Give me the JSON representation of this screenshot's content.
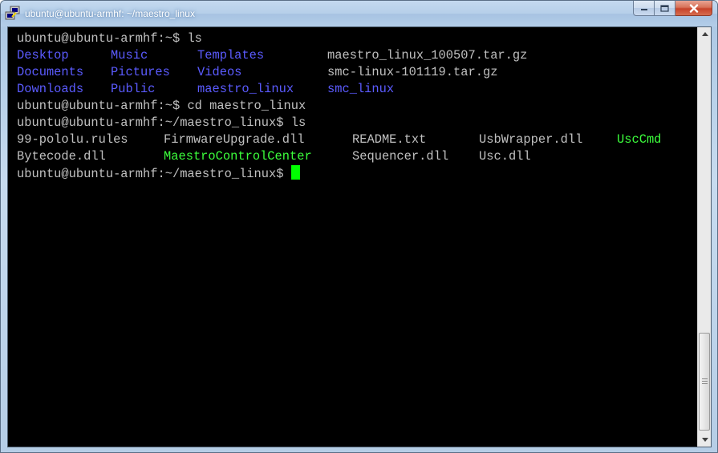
{
  "window": {
    "title": "ubuntu@ubuntu-armhf: ~/maestro_linux"
  },
  "colors": {
    "background": "#000000",
    "text": "#c0c0c0",
    "directory": "#5b5bff",
    "executable": "#3cff3c",
    "cursor": "#00ff00"
  },
  "terminal": {
    "l1": {
      "prompt": "ubuntu@ubuntu-armhf:~$",
      "command": " ls"
    },
    "l2": {
      "c1": "Desktop",
      "c2": "Music",
      "c3": "Templates",
      "c4": "maestro_linux_100507.tar.gz"
    },
    "l3": {
      "c1": "Documents",
      "c2": "Pictures",
      "c3": "Videos",
      "c4": "smc-linux-101119.tar.gz"
    },
    "l4": {
      "c1": "Downloads",
      "c2": "Public",
      "c3": "maestro_linux",
      "c4": "smc_linux"
    },
    "l5": {
      "prompt": "ubuntu@ubuntu-armhf:~$",
      "command": " cd maestro_linux"
    },
    "l6": {
      "prompt": "ubuntu@ubuntu-armhf:~/maestro_linux$",
      "command": " ls"
    },
    "l7": {
      "c1": "99-pololu.rules",
      "c2": "FirmwareUpgrade.dll",
      "c3": "README.txt",
      "c4": "UsbWrapper.dll",
      "c5": "UscCmd"
    },
    "l8": {
      "c1": "Bytecode.dll",
      "c2": "MaestroControlCenter",
      "c3": "Sequencer.dll",
      "c4": "Usc.dll"
    },
    "l9": {
      "prompt": "ubuntu@ubuntu-armhf:~/maestro_linux$"
    }
  }
}
